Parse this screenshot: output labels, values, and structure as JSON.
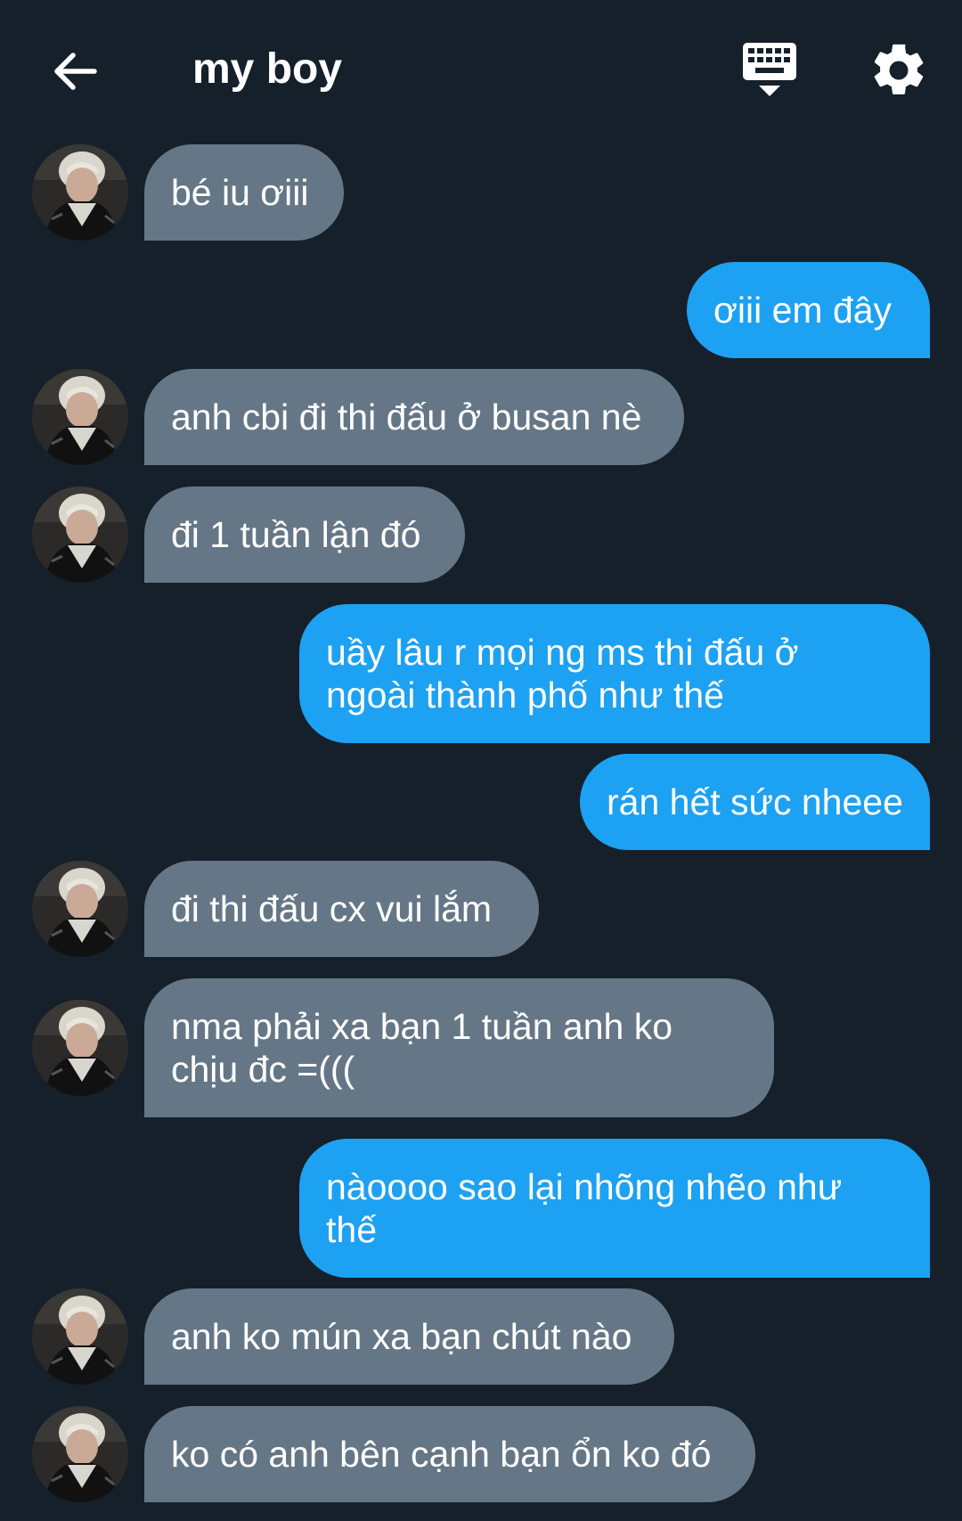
{
  "header": {
    "title": "my boy",
    "back_icon": "arrow-left-icon",
    "keyboard_icon": "keyboard-icon",
    "settings_icon": "gear-icon"
  },
  "colors": {
    "background": "#15202b",
    "incoming_bubble": "#657786",
    "outgoing_bubble": "#1da1f2",
    "text": "#ffffff"
  },
  "messages": [
    {
      "from": "them",
      "text": "bé iu ơiii"
    },
    {
      "from": "me",
      "text": "ơiii em đây"
    },
    {
      "from": "them",
      "text": "anh cbi đi thi đấu ở busan nè"
    },
    {
      "from": "them",
      "text": "đi 1 tuần lận đó"
    },
    {
      "from": "me",
      "text": "uầy lâu r mọi ng ms thi đấu ở\nngoài thành phố như thế"
    },
    {
      "from": "me",
      "text": "rán hết sức nheee"
    },
    {
      "from": "them",
      "text": "đi thi đấu cx vui lắm"
    },
    {
      "from": "them",
      "text": "nma phải xa bạn 1 tuần anh ko\nchịu đc =((("
    },
    {
      "from": "me",
      "text": "nàoooo sao lại nhõng nhẽo như\nthế"
    },
    {
      "from": "them",
      "text": "anh ko mún xa bạn chút nào"
    },
    {
      "from": "them",
      "text": "ko có anh bên cạnh bạn ổn ko đó"
    }
  ]
}
